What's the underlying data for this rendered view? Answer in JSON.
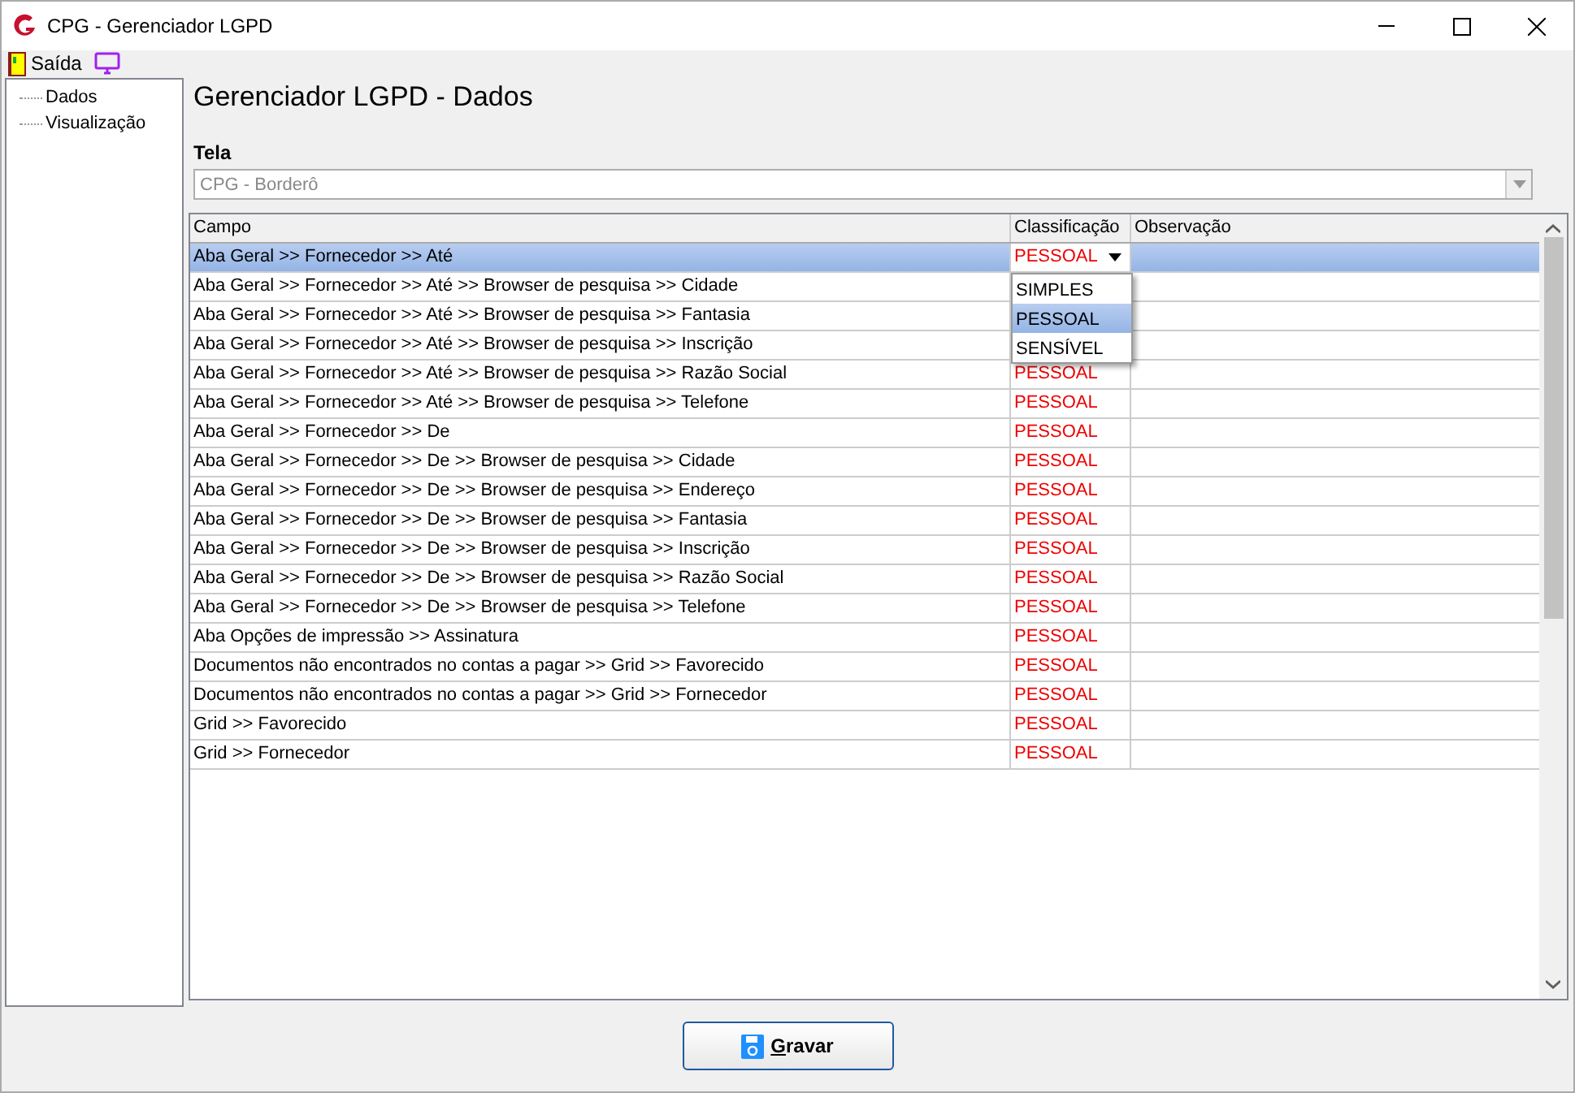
{
  "window": {
    "title": "CPG - Gerenciador LGPD"
  },
  "toolbar": {
    "items": [
      {
        "kind": "exit",
        "label": "Saída"
      },
      {
        "kind": "screen"
      }
    ]
  },
  "tree": {
    "items": [
      {
        "label": "Dados"
      },
      {
        "label": "Visualização"
      }
    ]
  },
  "heading": "Gerenciador LGPD - Dados",
  "screen_field": {
    "label": "Tela",
    "value": "CPG - Borderô"
  },
  "table": {
    "columns": [
      "Campo",
      "Classificação",
      "Observação"
    ],
    "rows": [
      {
        "campo": "Aba Geral >> Fornecedor >> Até",
        "classificacao": "PESSOAL",
        "selected": true
      },
      {
        "campo": "Aba Geral >> Fornecedor >> Até >> Browser de pesquisa >> Cidade",
        "selected": false
      },
      {
        "campo": "Aba Geral >> Fornecedor >> Até >> Browser de pesquisa >> Fantasia",
        "selected": false
      },
      {
        "campo": "Aba Geral >> Fornecedor >> Até >> Browser de pesquisa >> Inscrição",
        "selected": false
      },
      {
        "campo": "Aba Geral >> Fornecedor >> Até >> Browser de pesquisa >> Razão Social",
        "classificacao": "PESSOAL",
        "selected": false
      },
      {
        "campo": "Aba Geral >> Fornecedor >> Até >> Browser de pesquisa >> Telefone",
        "classificacao": "PESSOAL",
        "selected": false
      },
      {
        "campo": "Aba Geral >> Fornecedor >> De",
        "classificacao": "PESSOAL",
        "selected": false
      },
      {
        "campo": "Aba Geral >> Fornecedor >> De >> Browser de pesquisa >> Cidade",
        "classificacao": "PESSOAL",
        "selected": false
      },
      {
        "campo": "Aba Geral >> Fornecedor >> De >> Browser de pesquisa >> Endereço",
        "classificacao": "PESSOAL",
        "selected": false
      },
      {
        "campo": "Aba Geral >> Fornecedor >> De >> Browser de pesquisa >> Fantasia",
        "classificacao": "PESSOAL",
        "selected": false
      },
      {
        "campo": "Aba Geral >> Fornecedor >> De >> Browser de pesquisa >> Inscrição",
        "classificacao": "PESSOAL",
        "selected": false
      },
      {
        "campo": "Aba Geral >> Fornecedor >> De >> Browser de pesquisa >> Razão Social",
        "classificacao": "PESSOAL",
        "selected": false
      },
      {
        "campo": "Aba Geral >> Fornecedor >> De >> Browser de pesquisa >> Telefone",
        "classificacao": "PESSOAL",
        "selected": false
      },
      {
        "campo": "Aba Opções de impressão >> Assinatura",
        "classificacao": "PESSOAL",
        "selected": false
      },
      {
        "campo": "Documentos não encontrados no contas a pagar >> Grid >> Favorecido",
        "classificacao": "PESSOAL",
        "selected": false
      },
      {
        "campo": "Documentos não encontrados no contas a pagar >> Grid >> Fornecedor",
        "classificacao": "PESSOAL",
        "selected": false
      },
      {
        "campo": "Grid >> Favorecido",
        "classificacao": "PESSOAL",
        "selected": false
      },
      {
        "campo": "Grid >> Fornecedor",
        "classificacao": "PESSOAL",
        "selected": false
      }
    ]
  },
  "dropdown": {
    "options": [
      {
        "label": "SIMPLES",
        "selected": false
      },
      {
        "label": "PESSOAL",
        "selected": true
      },
      {
        "label": "SENSÍVEL",
        "selected": false
      }
    ]
  },
  "save_button": {
    "label": "Gravar"
  }
}
